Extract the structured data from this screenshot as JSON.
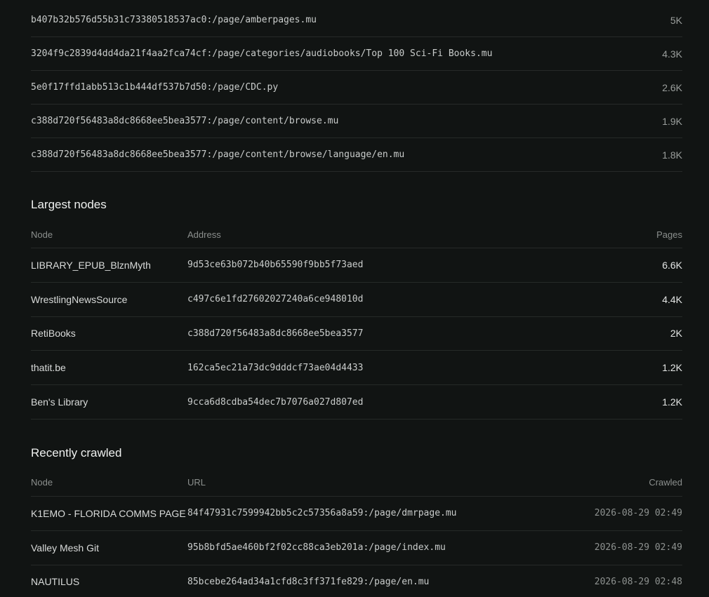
{
  "top_pages": [
    {
      "path": "b407b32b576d55b31c73380518537ac0:/page/amberpages.mu",
      "count": "5K"
    },
    {
      "path": "3204f9c2839d4dd4da21f4aa2fca74cf:/page/categories/audiobooks/Top 100 Sci-Fi Books.mu",
      "count": "4.3K"
    },
    {
      "path": "5e0f17ffd1abb513c1b444df537b7d50:/page/CDC.py",
      "count": "2.6K"
    },
    {
      "path": "c388d720f56483a8dc8668ee5bea3577:/page/content/browse.mu",
      "count": "1.9K"
    },
    {
      "path": "c388d720f56483a8dc8668ee5bea3577:/page/content/browse/language/en.mu",
      "count": "1.8K"
    }
  ],
  "largest_nodes": {
    "title": "Largest nodes",
    "headers": {
      "node": "Node",
      "address": "Address",
      "pages": "Pages"
    },
    "rows": [
      {
        "node": "LIBRARY_EPUB_BlznMyth",
        "address": "9d53ce63b072b40b65590f9bb5f73aed",
        "pages": "6.6K"
      },
      {
        "node": "WrestlingNewsSource",
        "address": "c497c6e1fd27602027240a6ce948010d",
        "pages": "4.4K"
      },
      {
        "node": "RetiBooks",
        "address": "c388d720f56483a8dc8668ee5bea3577",
        "pages": "2K"
      },
      {
        "node": "thatit.be",
        "address": "162ca5ec21a73dc9dddcf73ae04d4433",
        "pages": "1.2K"
      },
      {
        "node": "Ben's Library",
        "address": "9cca6d8cdba54dec7b7076a027d807ed",
        "pages": "1.2K"
      }
    ]
  },
  "recently_crawled": {
    "title": "Recently crawled",
    "headers": {
      "node": "Node",
      "url": "URL",
      "crawled": "Crawled"
    },
    "rows": [
      {
        "node": "K1EMO - FLORIDA COMMS PAGE",
        "url": "84f47931c7599942bb5c2c57356a8a59:/page/dmrpage.mu",
        "crawled": "2026-08-29 02:49"
      },
      {
        "node": "Valley Mesh Git",
        "url": "95b8bfd5ae460bf2f02cc88ca3eb201a:/page/index.mu",
        "crawled": "2026-08-29 02:49"
      },
      {
        "node": "NAUTILUS",
        "url": "85bcebe264ad34a1cfd8c3ff371fe829:/page/en.mu",
        "crawled": "2026-08-29 02:48"
      }
    ]
  }
}
